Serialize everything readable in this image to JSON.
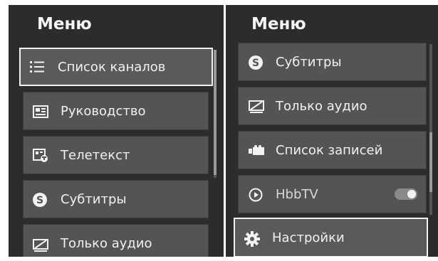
{
  "left_panel": {
    "title": "Меню",
    "items": [
      {
        "label": "Список каналов",
        "icon": "list-icon"
      },
      {
        "label": "Руководство",
        "icon": "guide-icon"
      },
      {
        "label": "Телетекст",
        "icon": "teletext-icon"
      },
      {
        "label": "Субтитры",
        "icon": "subtitles-icon"
      },
      {
        "label": "Только аудио",
        "icon": "audio-only-icon"
      }
    ]
  },
  "right_panel": {
    "title": "Меню",
    "items": [
      {
        "label": "Субтитры",
        "icon": "subtitles-icon"
      },
      {
        "label": "Только аудио",
        "icon": "audio-only-icon"
      },
      {
        "label": "Список записей",
        "icon": "recordings-icon"
      },
      {
        "label": "HbbTV",
        "icon": "hbbtv-icon",
        "toggle": "on"
      },
      {
        "label": "Настройки",
        "icon": "settings-gear-icon"
      }
    ]
  },
  "colors": {
    "panel_bg": "#2c2c2c",
    "item_bg": "#545454",
    "highlight": "#f2f2f2"
  }
}
